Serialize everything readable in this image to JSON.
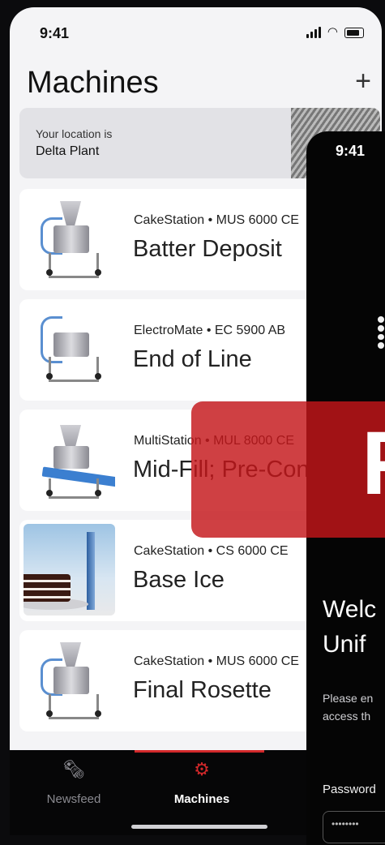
{
  "status_bar": {
    "time": "9:41",
    "icons": [
      "signal-icon",
      "wifi-icon",
      "battery-icon"
    ]
  },
  "header": {
    "title": "Machines",
    "add_icon": "+"
  },
  "location": {
    "label": "Your location is",
    "value": "Delta Plant"
  },
  "machines": [
    {
      "label": "CakeStation • MUS 6000 CE",
      "name": "Batter Deposit",
      "image": "batter-deposit-machine"
    },
    {
      "label": "ElectroMate • EC 5900 AB",
      "name": "End of Line",
      "image": "end-of-line-machine"
    },
    {
      "label": "MultiStation • MUL 8000 CE",
      "name": "Mid-Fill; Pre-Con",
      "image": "multistation-machine"
    },
    {
      "label": "CakeStation • CS 6000 CE",
      "name": "Base Ice",
      "image": "cake-photo"
    },
    {
      "label": "CakeStation • MUS 6000 CE",
      "name": "Final Rosette",
      "image": "final-rosette-machine"
    }
  ],
  "tabs": [
    {
      "label": "Newsfeed",
      "icon": "newsfeed-icon",
      "active": false
    },
    {
      "label": "Machines",
      "icon": "machines-icon",
      "active": true
    }
  ],
  "overlay_screen": {
    "time": "9:41",
    "welcome_line1": "Welc",
    "welcome_line2": "Unif",
    "desc_line1": "Please en",
    "desc_line2": "access th",
    "password_label": "Password",
    "password_value": "••••••••"
  },
  "overlay_banner": {
    "letter": "F",
    "color": "#c5161a"
  },
  "colors": {
    "accent": "#d2282a",
    "background": "#f4f4f6",
    "tab_bar": "#060607"
  }
}
